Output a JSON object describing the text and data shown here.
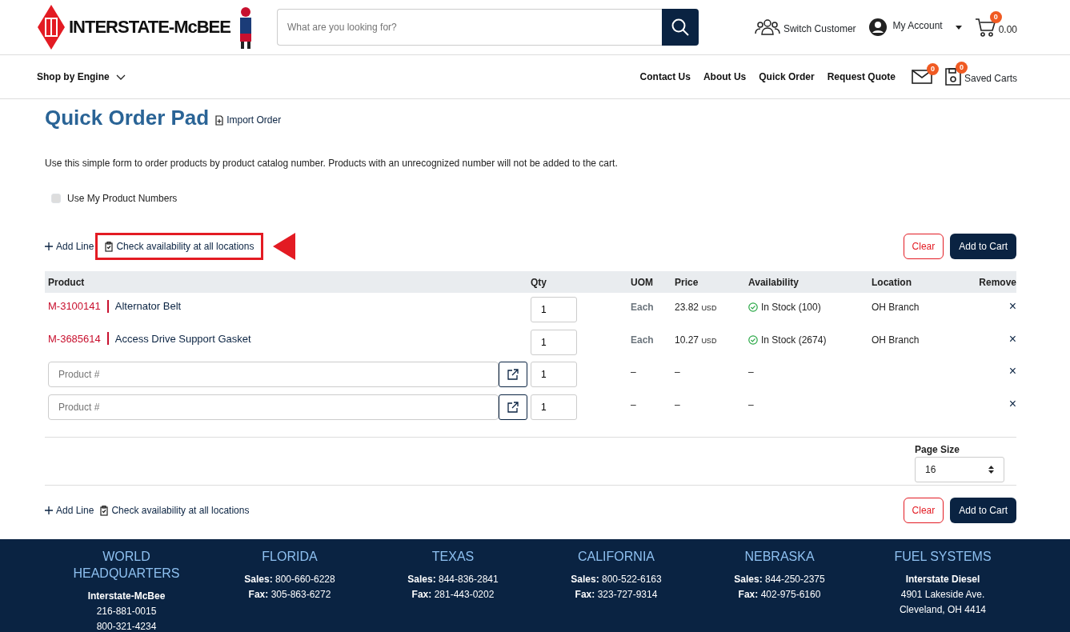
{
  "header": {
    "logo_text": "INTERSTATE-McBEE",
    "search": {
      "placeholder": "What are you looking for?"
    },
    "switch_customer": "Switch Customer",
    "my_account": "My Account",
    "cart": {
      "count": "0",
      "total": "0.00"
    }
  },
  "nav": {
    "shop_by_engine": "Shop by Engine",
    "links": [
      "Contact Us",
      "About Us",
      "Quick Order",
      "Request Quote"
    ],
    "messages_count": "0",
    "saved_carts": {
      "count": "0",
      "label": "Saved Carts"
    }
  },
  "page": {
    "title": "Quick Order Pad",
    "import_order": "Import Order",
    "description": "Use this simple form to order products by product catalog number. Products with an unrecognized number will not be added to the cart.",
    "use_my_numbers": {
      "label": "Use My Product Numbers",
      "checked": false
    }
  },
  "toolbar_top": {
    "add_line": "Add Line",
    "check_availability": "Check availability at all locations",
    "highlighted": true,
    "clear": "Clear",
    "add_to_cart": "Add to Cart"
  },
  "table": {
    "columns": [
      "Product",
      "Qty",
      "UOM",
      "Price",
      "Availability",
      "Location",
      "Remove"
    ],
    "rows": [
      {
        "kind": "item",
        "number": "M-3100141",
        "name": "Alternator Belt",
        "qty": "1",
        "uom": "Each",
        "price": "23.82",
        "currency": "USD",
        "availability": "In Stock (100)",
        "location": "OH Branch",
        "remove": "×"
      },
      {
        "kind": "item",
        "number": "M-3685614",
        "name": "Access Drive Support Gasket",
        "qty": "1",
        "uom": "Each",
        "price": "10.27",
        "currency": "USD",
        "availability": "In Stock (2674)",
        "location": "OH Branch",
        "remove": "×"
      },
      {
        "kind": "entry",
        "placeholder": "Product #",
        "qty": "1",
        "uom": "–",
        "price": "–",
        "availability": "–",
        "remove": "×"
      },
      {
        "kind": "entry",
        "placeholder": "Product #",
        "qty": "1",
        "uom": "–",
        "price": "–",
        "availability": "–",
        "remove": "×"
      }
    ]
  },
  "page_size": {
    "label": "Page Size",
    "value": "16"
  },
  "toolbar_bottom": {
    "add_line": "Add Line",
    "check_availability": "Check availability at all locations",
    "highlighted": false,
    "clear": "Clear",
    "add_to_cart": "Add to Cart"
  },
  "footer": [
    {
      "title": "WORLD HEADQUARTERS",
      "lines": [
        {
          "text": "Interstate-McBee",
          "bold": true
        },
        {
          "text": "216-881-0015",
          "bold": false
        },
        {
          "text": "800-321-4234",
          "bold": false
        }
      ]
    },
    {
      "title": "FLORIDA",
      "lines": [
        {
          "text": "**Sales:** 800-660-6228",
          "bold": false
        },
        {
          "text": "**Fax:** 305-863-6272",
          "bold": false
        }
      ]
    },
    {
      "title": "TEXAS",
      "lines": [
        {
          "text": "**Sales:** 844-836-2841",
          "bold": false
        },
        {
          "text": "**Fax:** 281-443-0202",
          "bold": false
        }
      ]
    },
    {
      "title": "CALIFORNIA",
      "lines": [
        {
          "text": "**Sales:** 800-522-6163",
          "bold": false
        },
        {
          "text": "**Fax:** 323-727-9314",
          "bold": false
        }
      ]
    },
    {
      "title": "NEBRASKA",
      "lines": [
        {
          "text": "**Sales:** 844-250-2375",
          "bold": false
        },
        {
          "text": "**Fax:** 402-975-6160",
          "bold": false
        }
      ]
    },
    {
      "title": "FUEL SYSTEMS",
      "lines": [
        {
          "text": "Interstate Diesel",
          "bold": true
        },
        {
          "text": "4901 Lakeside Ave.",
          "bold": false
        },
        {
          "text": "Cleveland, OH 4414",
          "bold": false
        }
      ]
    }
  ]
}
